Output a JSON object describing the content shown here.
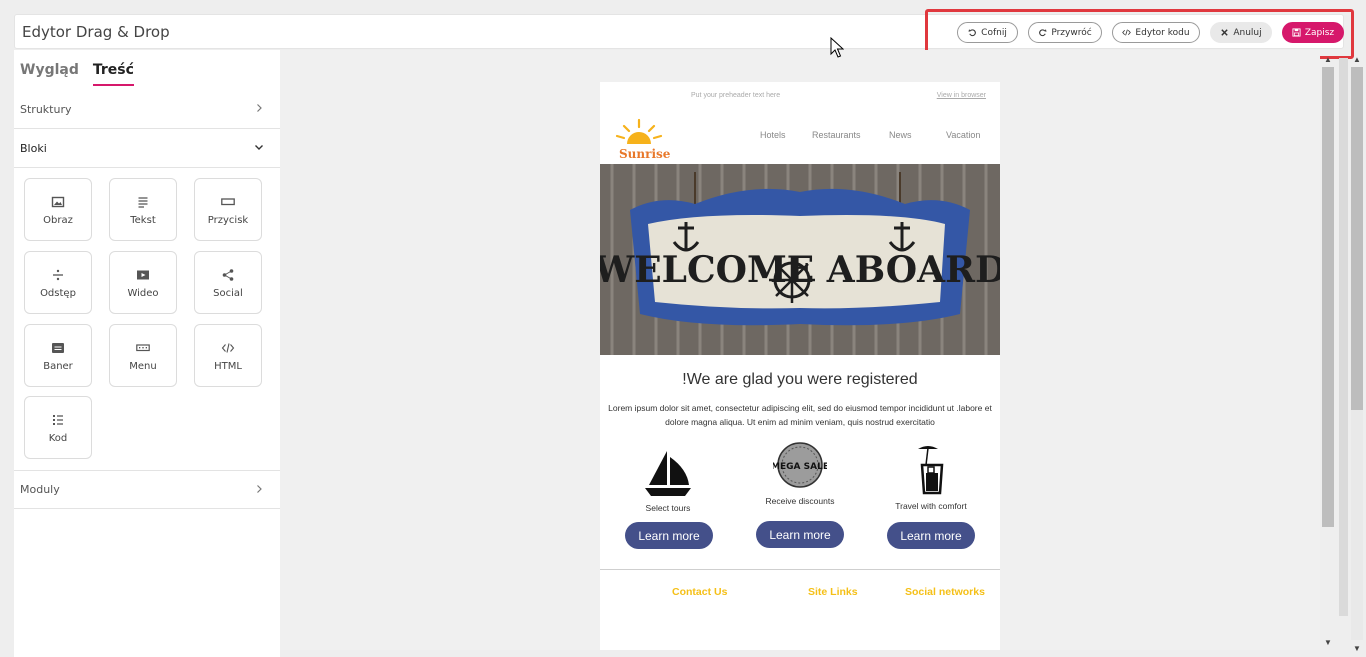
{
  "header": {
    "title": "Edytor Drag & Drop",
    "buttons": {
      "undo": "Cofnij",
      "redo": "Przywróć",
      "code_editor": "Edytor kodu",
      "cancel": "Anuluj",
      "save": "Zapisz"
    }
  },
  "sidebar": {
    "tabs": [
      "Wygląd",
      "Treść"
    ],
    "active_tab": "Treść",
    "sections": {
      "structures": "Struktury",
      "blocks": "Bloki",
      "modules": "Moduly"
    },
    "blocks": [
      {
        "label": "Obraz",
        "icon": "image-icon"
      },
      {
        "label": "Tekst",
        "icon": "text-icon"
      },
      {
        "label": "Przycisk",
        "icon": "button-icon"
      },
      {
        "label": "Odstęp",
        "icon": "spacer-icon"
      },
      {
        "label": "Wideo",
        "icon": "video-icon"
      },
      {
        "label": "Social",
        "icon": "share-icon"
      },
      {
        "label": "Baner",
        "icon": "banner-icon"
      },
      {
        "label": "Menu",
        "icon": "menu-icon"
      },
      {
        "label": "HTML",
        "icon": "html-icon"
      },
      {
        "label": "Kod",
        "icon": "list-icon"
      }
    ]
  },
  "email": {
    "preheader": "Put your preheader text here",
    "view_in_browser": "View in browser",
    "logo_text": "Sunrise",
    "nav": [
      "Hotels",
      "Restaurants",
      "News",
      "Vacation"
    ],
    "hero_text": "WELCOME ABOARD",
    "heading": "!We are glad you were registered",
    "body": "Lorem ipsum dolor sit amet, consectetur adipiscing elit, sed do eiusmod tempor incididunt ut .labore et dolore magna aliqua. Ut enim ad minim veniam, quis nostrud exercitatio",
    "features": [
      {
        "text": "Select tours",
        "icon": "sailboat-icon",
        "button": "Learn more"
      },
      {
        "text": "Receive discounts",
        "icon": "mega-sale-icon",
        "badge": "MEGA SALE",
        "button": "Learn more"
      },
      {
        "text": "Travel with comfort",
        "icon": "cocktail-icon",
        "button": "Learn more"
      }
    ],
    "footer_links": [
      "Contact Us",
      "Site Links",
      "Social networks"
    ]
  },
  "colors": {
    "accent": "#d6186b",
    "highlight": "#e0383e",
    "button": "#44508a",
    "footer_link": "#f5c018"
  }
}
